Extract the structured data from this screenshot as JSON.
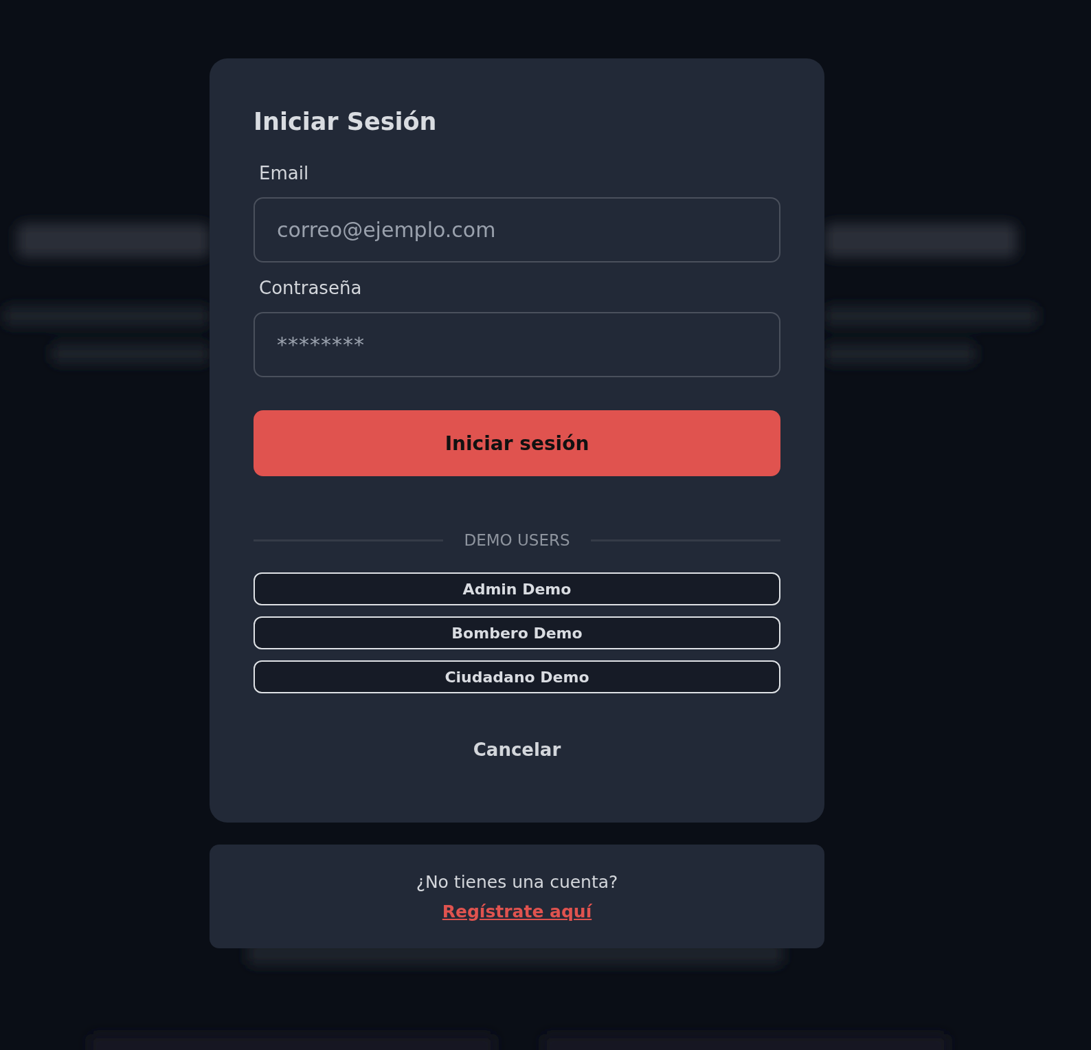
{
  "dialog": {
    "title": "Iniciar Sesión",
    "email": {
      "label": "Email",
      "placeholder": "correo@ejemplo.com"
    },
    "password": {
      "label": "Contraseña",
      "placeholder": "********"
    },
    "submit": "Iniciar sesión",
    "divider": "DEMO USERS",
    "demo_users": [
      "Admin Demo",
      "Bombero Demo",
      "Ciudadano Demo"
    ],
    "cancel": "Cancelar"
  },
  "register": {
    "question": "¿No tienes una cuenta?",
    "link": "Regístrate aquí"
  }
}
